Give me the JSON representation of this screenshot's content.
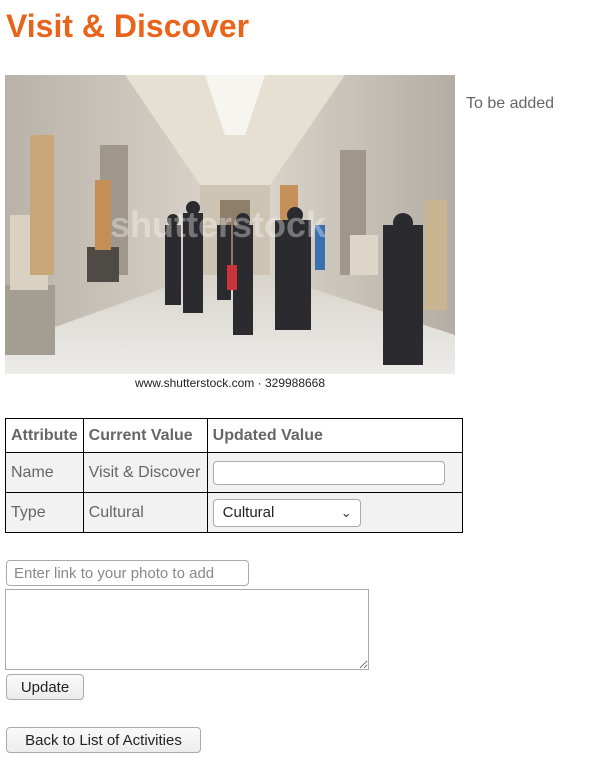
{
  "page": {
    "title": "Visit & Discover",
    "side_note": "To be added"
  },
  "photo": {
    "description_icon": "museum-gallery-photo",
    "watermark": "shutterstock",
    "credit": "www.shutterstock.com · 329988668"
  },
  "table": {
    "headers": [
      "Attribute",
      "Current Value",
      "Updated Value"
    ],
    "rows": [
      {
        "attribute": "Name",
        "current": "Visit & Discover",
        "updated": ""
      },
      {
        "attribute": "Type",
        "current": "Cultural",
        "updated": "Cultural"
      }
    ]
  },
  "form": {
    "photo_link_placeholder": "Enter link to your photo to add",
    "update_label": "Update",
    "back_label": "Back to List of Activities"
  },
  "colors": {
    "title": "#e8641b"
  }
}
